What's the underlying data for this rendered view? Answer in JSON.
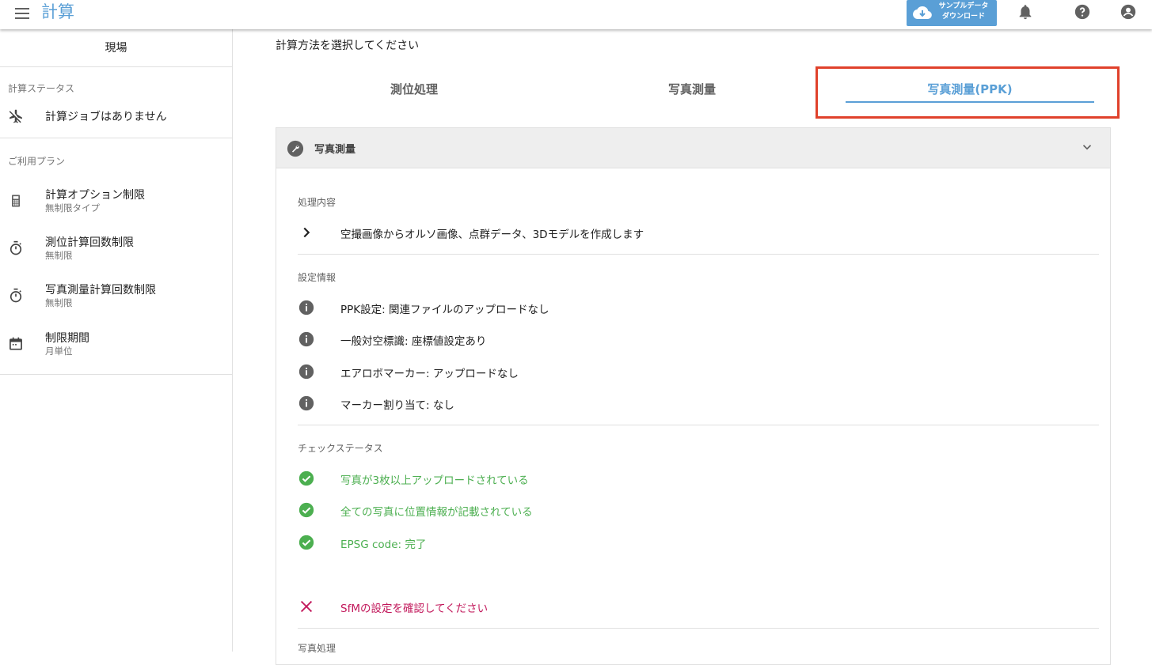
{
  "header": {
    "title": "計算",
    "download_line1": "サンプルデータ",
    "download_line2": "ダウンロード",
    "icons": [
      "menu-icon",
      "cloud-download-icon",
      "bell-icon",
      "help-icon",
      "account-icon"
    ]
  },
  "sidebar": {
    "site_label": "現場",
    "status_section": "計算ステータス",
    "status_item": "計算ジョブはありません",
    "plan_section": "ご利用プラン",
    "plans": [
      {
        "title": "計算オプション制限",
        "sub": "無制限タイプ",
        "icon": "calculator-icon"
      },
      {
        "title": "測位計算回数制限",
        "sub": "無制限",
        "icon": "timer-icon"
      },
      {
        "title": "写真測量計算回数制限",
        "sub": "無制限",
        "icon": "timer-icon"
      },
      {
        "title": "制限期間",
        "sub": "月単位",
        "icon": "calendar-icon"
      }
    ]
  },
  "main": {
    "prompt": "計算方法を選択してください",
    "tabs": [
      {
        "label": "測位処理",
        "active": false
      },
      {
        "label": "写真測量",
        "active": false
      },
      {
        "label": "写真測量(PPK)",
        "active": true
      }
    ],
    "panel": {
      "title": "写真測量",
      "process_title": "処理内容",
      "process_text": "空撮画像からオルソ画像、点群データ、3Dモデルを作成します",
      "settings_title": "設定情報",
      "settings": [
        "PPK設定: 関連ファイルのアップロードなし",
        "一般対空標識: 座標値設定あり",
        "エアロボマーカー: アップロードなし",
        "マーカー割り当て: なし"
      ],
      "check_title": "チェックステータス",
      "checks_ok": [
        "写真が3枚以上アップロードされている",
        "全ての写真に位置情報が記載されている",
        "EPSG code: 完了"
      ],
      "check_ng": "SfMの設定を確認してください",
      "next_section": "写真処理"
    }
  },
  "colors": {
    "accent": "#5a9fd6",
    "ok": "#4caf50",
    "ng": "#c2185b",
    "highlight": "#e0412b"
  }
}
